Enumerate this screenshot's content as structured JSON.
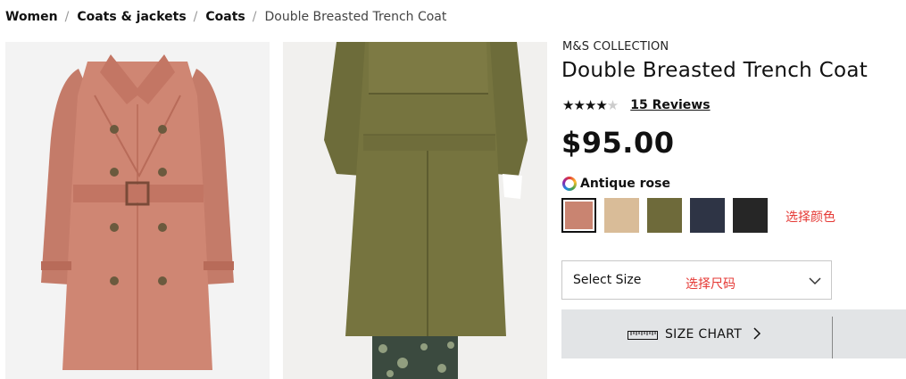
{
  "breadcrumb": {
    "items": [
      "Women",
      "Coats & jackets",
      "Coats"
    ],
    "separator": "/",
    "current": "Double Breasted Trench Coat"
  },
  "product": {
    "brand": "M&S COLLECTION",
    "title": "Double Breasted Trench Coat",
    "rating": 4,
    "rating_max": 5,
    "stars_glyphs": "★★★★★",
    "reviews_label": "15 Reviews",
    "price": "$95.00"
  },
  "colour": {
    "selected_name": "Antique rose",
    "swatches": [
      "#c98471",
      "#d9bc98",
      "#6e6a3a",
      "#2e3445",
      "#262626"
    ],
    "note": "选择颜色"
  },
  "size": {
    "placeholder": "Select Size",
    "note": "选择尺码"
  },
  "size_chart": {
    "label": "SIZE CHART"
  },
  "icons": {
    "colour_wheel": "colour-wheel-icon",
    "dropdown": "chevron-down-icon",
    "ruler": "ruler-icon",
    "chevron": "chevron-right-icon"
  },
  "colors": {
    "note_red": "#e53935",
    "size_chart_bg": "#e2e4e6"
  }
}
